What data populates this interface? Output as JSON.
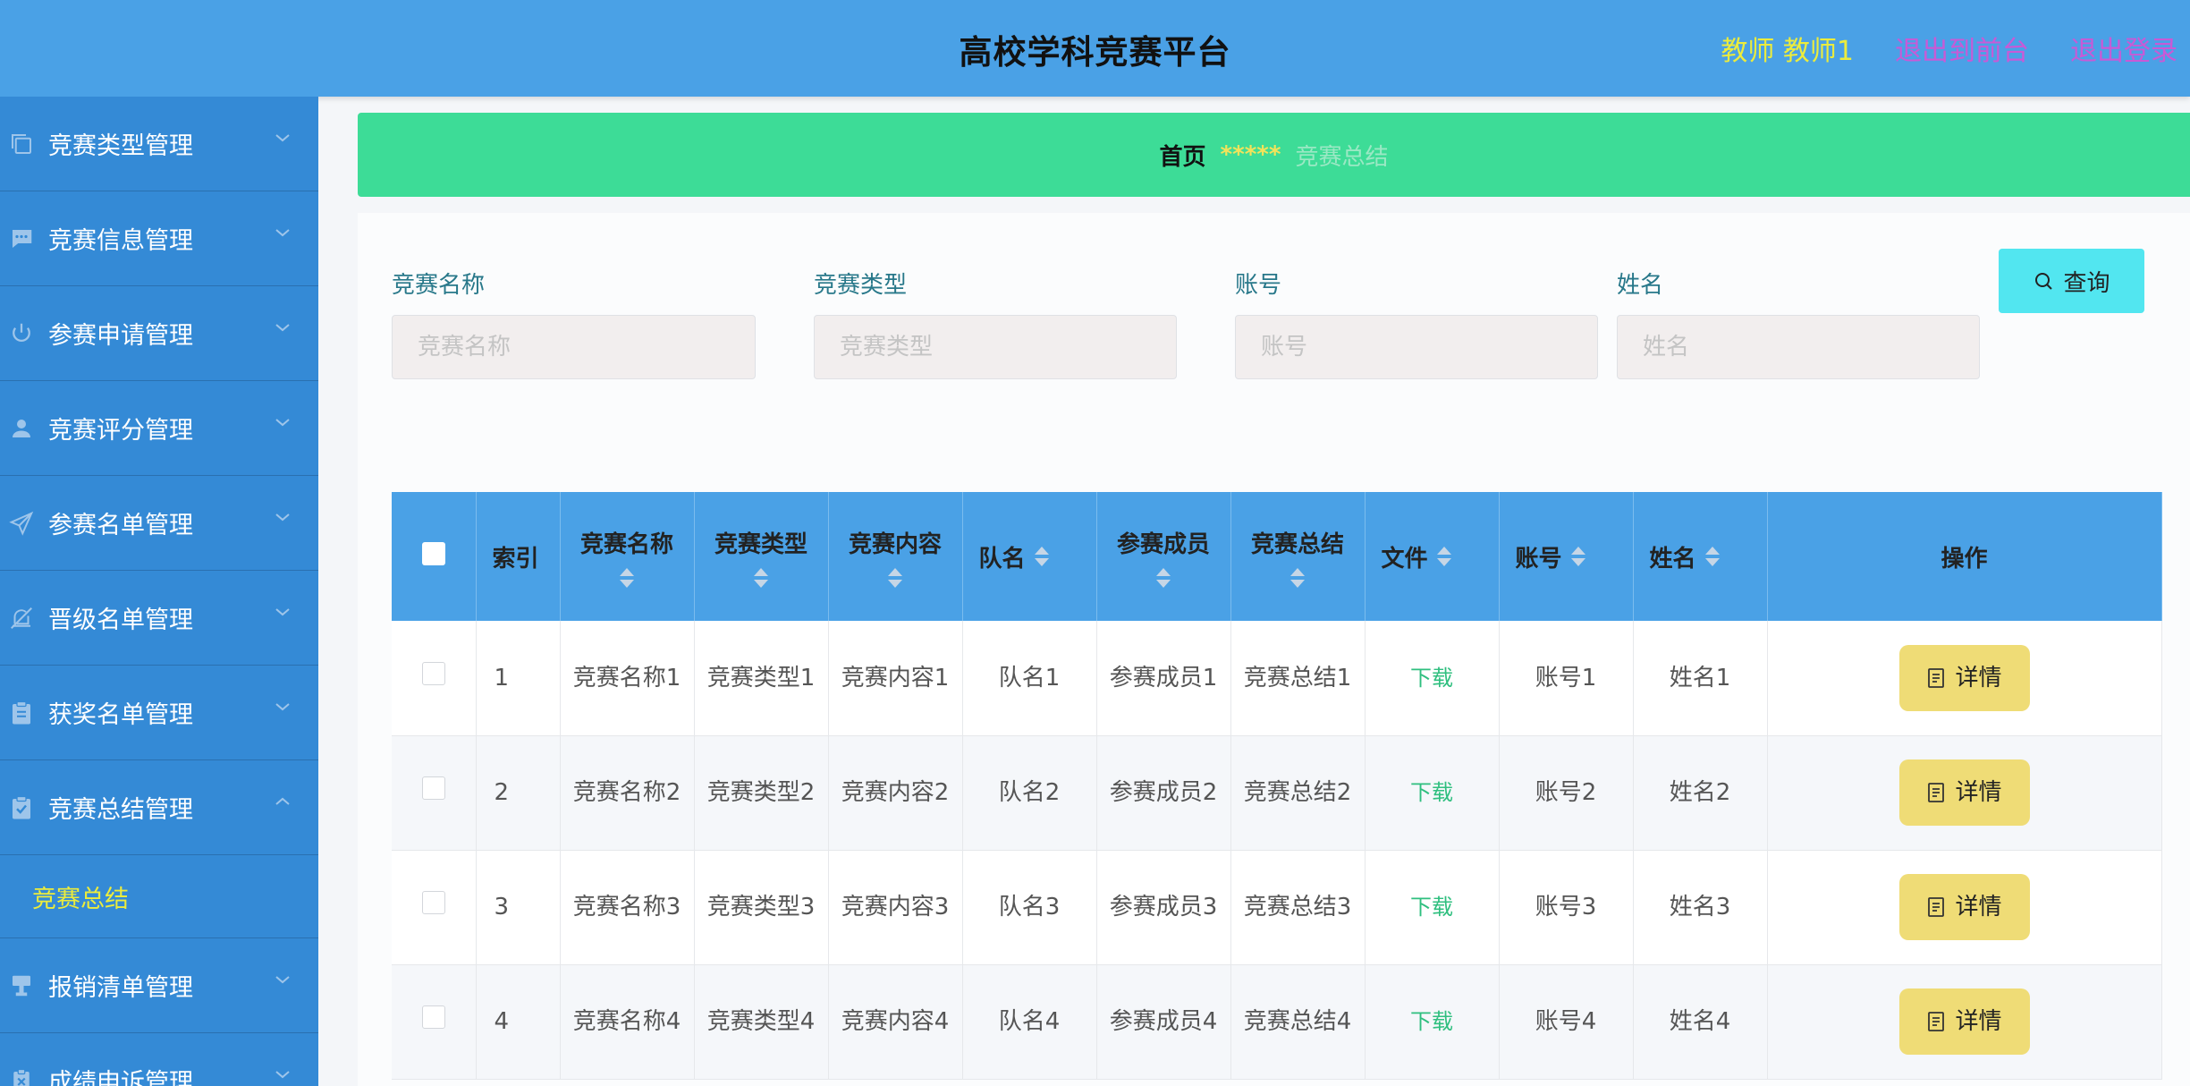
{
  "header": {
    "title": "高校学科竞赛平台",
    "user": "教师 教师1",
    "front_link": "退出到前台",
    "logout_link": "退出登录"
  },
  "sidebar": {
    "items": [
      {
        "label": "竞赛类型管理",
        "icon": "copy-icon"
      },
      {
        "label": "竞赛信息管理",
        "icon": "message-icon"
      },
      {
        "label": "参赛申请管理",
        "icon": "power-icon"
      },
      {
        "label": "竞赛评分管理",
        "icon": "user-icon"
      },
      {
        "label": "参赛名单管理",
        "icon": "send-icon"
      },
      {
        "label": "晋级名单管理",
        "icon": "bell-off-icon"
      },
      {
        "label": "获奖名单管理",
        "icon": "clipboard-icon"
      },
      {
        "label": "竞赛总结管理",
        "icon": "checklist-icon",
        "expanded": true
      },
      {
        "label": "报销清单管理",
        "icon": "stamp-icon"
      },
      {
        "label": "成绩申诉管理",
        "icon": "trophy-icon"
      }
    ],
    "sub_item": "竞赛总结"
  },
  "breadcrumb": {
    "home": "首页",
    "separator": "*****",
    "current": "竞赛总结"
  },
  "search": {
    "fields": [
      {
        "label": "竞赛名称",
        "placeholder": "竞赛名称"
      },
      {
        "label": "竞赛类型",
        "placeholder": "竞赛类型"
      },
      {
        "label": "账号",
        "placeholder": "账号"
      },
      {
        "label": "姓名",
        "placeholder": "姓名"
      }
    ],
    "button": "查询"
  },
  "table": {
    "headers": [
      "索引",
      "竞赛名称",
      "竞赛类型",
      "竞赛内容",
      "队名",
      "参赛成员",
      "竞赛总结",
      "文件",
      "账号",
      "姓名",
      "操作"
    ],
    "rows": [
      {
        "index": "1",
        "name": "竞赛名称1",
        "type": "竞赛类型1",
        "content": "竞赛内容1",
        "team": "队名1",
        "members": "参赛成员1",
        "summary": "竞赛总结1",
        "file": "下载",
        "account": "账号1",
        "person": "姓名1",
        "action": "详情"
      },
      {
        "index": "2",
        "name": "竞赛名称2",
        "type": "竞赛类型2",
        "content": "竞赛内容2",
        "team": "队名2",
        "members": "参赛成员2",
        "summary": "竞赛总结2",
        "file": "下载",
        "account": "账号2",
        "person": "姓名2",
        "action": "详情"
      },
      {
        "index": "3",
        "name": "竞赛名称3",
        "type": "竞赛类型3",
        "content": "竞赛内容3",
        "team": "队名3",
        "members": "参赛成员3",
        "summary": "竞赛总结3",
        "file": "下载",
        "account": "账号3",
        "person": "姓名3",
        "action": "详情"
      },
      {
        "index": "4",
        "name": "竞赛名称4",
        "type": "竞赛类型4",
        "content": "竞赛内容4",
        "team": "队名4",
        "members": "参赛成员4",
        "summary": "竞赛总结4",
        "file": "下载",
        "account": "账号4",
        "person": "姓名4",
        "action": "详情"
      }
    ]
  },
  "colors": {
    "header_bg": "#4aa1e6",
    "sidebar_bg": "#348ad6",
    "breadcrumb_bg": "#3ddc97",
    "search_btn": "#52e6f0",
    "detail_btn": "#efdc76",
    "accent_yellow": "#ecec3c",
    "link_purple": "#c85ad6",
    "download_green": "#2fbf7f"
  }
}
